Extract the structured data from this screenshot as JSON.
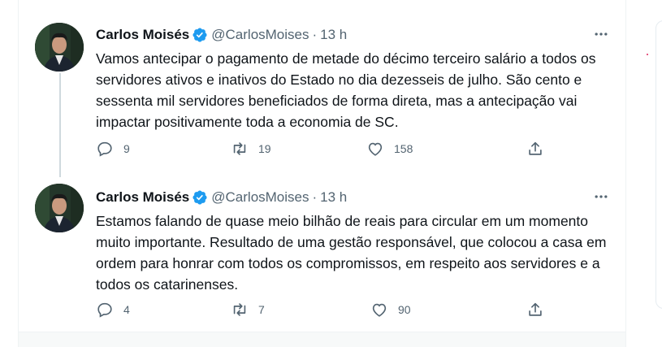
{
  "tweets": [
    {
      "author_name": "Carlos Moisés",
      "handle": "@CarlosMoises",
      "dot": "·",
      "time": "13 h",
      "text": "Vamos antecipar o pagamento de metade do décimo terceiro salário a todos os servidores ativos e inativos do Estado no dia dezesseis de julho. São cento e sessenta mil servidores beneficiados de forma direta, mas a antecipação vai impactar positivamente toda a economia de SC.",
      "replies": "9",
      "retweets": "19",
      "likes": "158"
    },
    {
      "author_name": "Carlos Moisés",
      "handle": "@CarlosMoises",
      "dot": "·",
      "time": "13 h",
      "text": "Estamos falando de quase meio bilhão de reais para circular em um momento muito importante. Resultado de uma gestão responsável, que colocou a casa em ordem para honrar com todos os compromissos, em respeito aos servidores e a todos os catarinenses.",
      "replies": "4",
      "retweets": "7",
      "likes": "90"
    }
  ],
  "icons": {
    "verified": "verified-badge-icon",
    "more": "more-options-icon",
    "reply": "reply-icon",
    "retweet": "retweet-icon",
    "like": "like-icon",
    "share": "share-icon"
  },
  "colors": {
    "text": "#0f1419",
    "secondary": "#536471",
    "verified": "#1d9bf0",
    "border": "#eff3f4"
  }
}
